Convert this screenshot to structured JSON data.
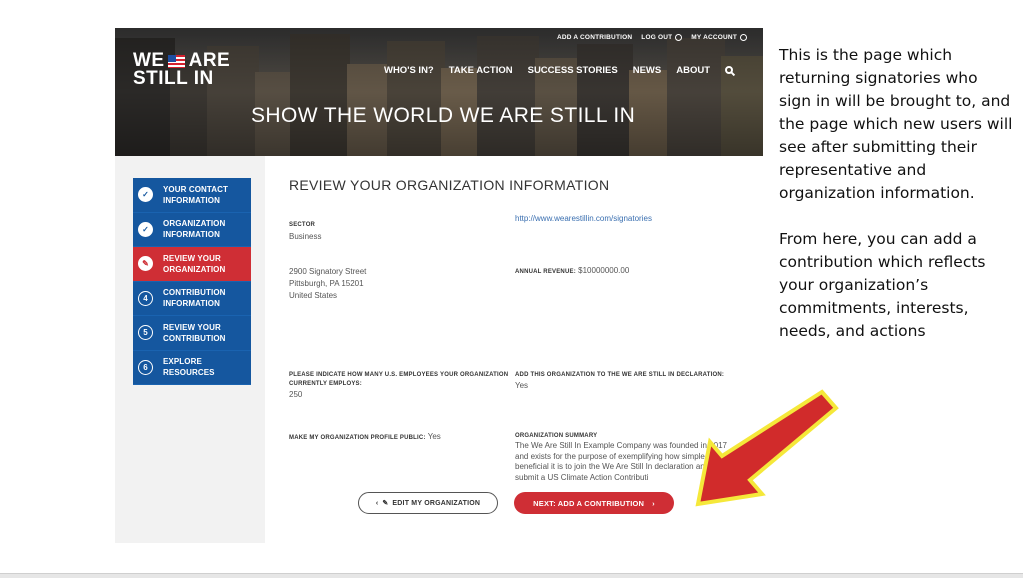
{
  "header": {
    "logo_line1": "WE",
    "logo_word_are": "ARE",
    "logo_line2": "STILL IN",
    "utility": [
      "ADD A CONTRIBUTION",
      "LOG OUT",
      "MY ACCOUNT"
    ],
    "nav": [
      "WHO'S IN?",
      "TAKE ACTION",
      "SUCCESS STORIES",
      "NEWS",
      "ABOUT"
    ],
    "hero_title": "SHOW THE WORLD WE ARE STILL IN"
  },
  "steps": [
    {
      "label": "YOUR CONTACT INFORMATION",
      "state": "done",
      "icon": "check-icon"
    },
    {
      "label": "ORGANIZATION INFORMATION",
      "state": "done",
      "icon": "check-icon"
    },
    {
      "label": "REVIEW YOUR ORGANIZATION",
      "state": "active",
      "icon": "pencil-icon"
    },
    {
      "label": "CONTRIBUTION INFORMATION",
      "state": "pending",
      "num": "4"
    },
    {
      "label": "REVIEW YOUR CONTRIBUTION",
      "state": "pending",
      "num": "5"
    },
    {
      "label": "EXPLORE RESOURCES",
      "state": "pending",
      "num": "6"
    }
  ],
  "review": {
    "title": "REVIEW YOUR ORGANIZATION INFORMATION",
    "sector_label": "SECTOR",
    "sector_value": "Business",
    "website": "http://www.wearestillin.com/signatories",
    "address_line1": "2900 Signatory Street",
    "address_line2": "Pittsburgh, PA 15201",
    "address_line3": "United States",
    "revenue_label": "ANNUAL REVENUE:",
    "revenue_value": "$10000000.00",
    "employees_label": "PLEASE INDICATE HOW MANY U.S. EMPLOYEES YOUR ORGANIZATION CURRENTLY EMPLOYS:",
    "employees_value": "250",
    "declaration_label": "ADD THIS ORGANIZATION TO THE WE ARE STILL IN DECLARATION:",
    "declaration_value": "Yes",
    "public_label": "MAKE MY ORGANIZATION PROFILE PUBLIC:",
    "public_value": "Yes",
    "summary_label": "ORGANIZATION SUMMARY",
    "summary_value": "The We Are Still In Example Company was founded in 2017 and exists for the purpose of exemplifying how simple and beneficial it is to join the We Are Still In declaration and submit a US Climate Action Contributi"
  },
  "buttons": {
    "edit_label": "EDIT MY ORGANIZATION",
    "next_label": "NEXT: ADD A CONTRIBUTION"
  },
  "annotation": {
    "para1": "This is the page which returning signatories who sign in will be brought to, and the page which new users will see after submitting their representative and organization information.",
    "para2": "From here, you can add a contribution which reflects your organization’s commitments, interests, needs, and actions"
  },
  "colors": {
    "primary_blue": "#15579f",
    "active_red": "#cf2e35",
    "arrow_red": "#d12b2b",
    "arrow_border": "#f5e83a"
  }
}
